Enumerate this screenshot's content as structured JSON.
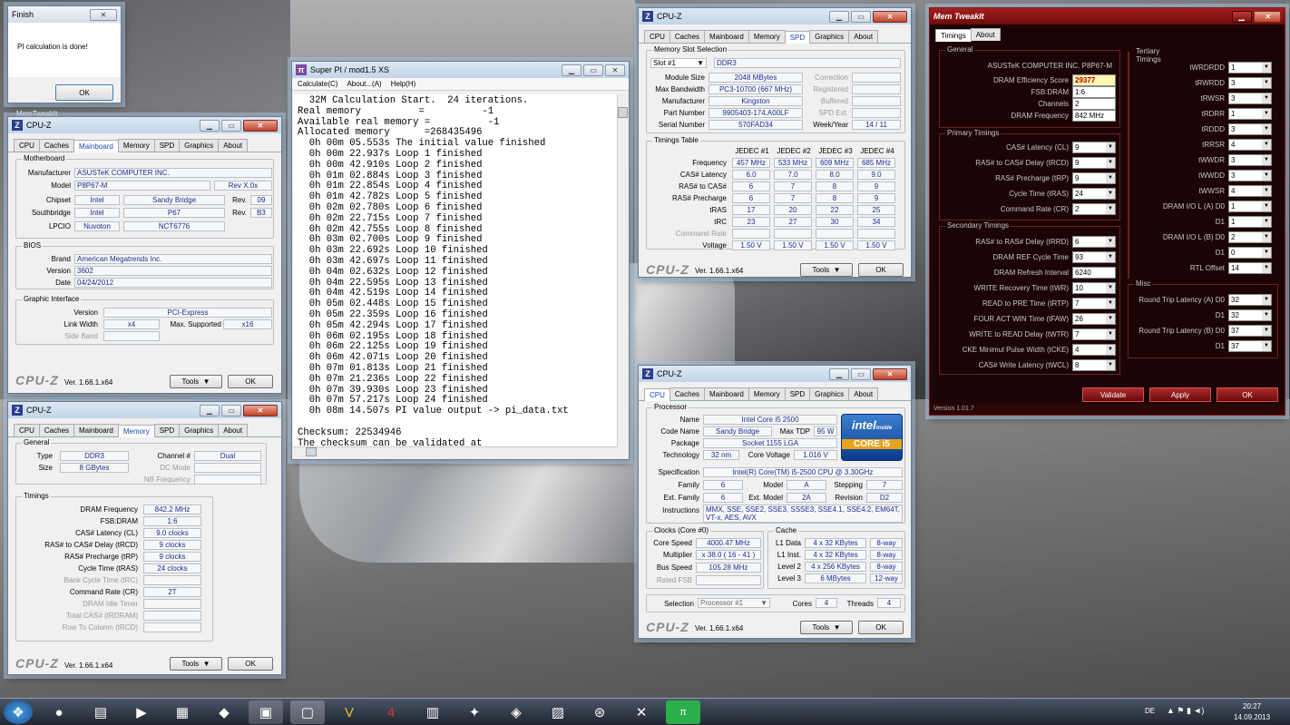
{
  "finish": {
    "title": "Finish",
    "message": "PI calculation is done!",
    "ok": "OK"
  },
  "memtweak_label": "MemTweakIt",
  "superpi": {
    "title": "Super PI / mod1.5 XS",
    "menu": [
      "Calculate(C)",
      "About...(A)",
      "Help(H)"
    ],
    "lines": [
      "  32M Calculation Start.  24 iterations.",
      "Real memory          =          -1",
      "Available real memory =          -1",
      "Allocated memory      =268435496",
      "  0h 00m 05.553s The initial value finished",
      "  0h 00m 22.937s Loop 1 finished",
      "  0h 00m 42.910s Loop 2 finished",
      "  0h 01m 02.884s Loop 3 finished",
      "  0h 01m 22.854s Loop 4 finished",
      "  0h 01m 42.782s Loop 5 finished",
      "  0h 02m 02.780s Loop 6 finished",
      "  0h 02m 22.715s Loop 7 finished",
      "  0h 02m 42.755s Loop 8 finished",
      "  0h 03m 02.700s Loop 9 finished",
      "  0h 03m 22.692s Loop 10 finished",
      "  0h 03m 42.697s Loop 11 finished",
      "  0h 04m 02.632s Loop 12 finished",
      "  0h 04m 22.595s Loop 13 finished",
      "  0h 04m 42.519s Loop 14 finished",
      "  0h 05m 02.448s Loop 15 finished",
      "  0h 05m 22.359s Loop 16 finished",
      "  0h 05m 42.294s Loop 17 finished",
      "  0h 06m 02.195s Loop 18 finished",
      "  0h 06m 22.125s Loop 19 finished",
      "  0h 06m 42.071s Loop 20 finished",
      "  0h 07m 01.813s Loop 21 finished",
      "  0h 07m 21.236s Loop 22 finished",
      "  0h 07m 39.930s Loop 23 finished",
      "  0h 07m 57.217s Loop 24 finished",
      "  0h 08m 14.507s PI value output -> pi_data.txt",
      "",
      "Checksum: 22534946",
      "The checksum can be validated at"
    ]
  },
  "cpuz_common": {
    "title": "CPU-Z",
    "tabs": [
      "CPU",
      "Caches",
      "Mainboard",
      "Memory",
      "SPD",
      "Graphics",
      "About"
    ],
    "version": "Ver. 1.66.1.x64",
    "tools": "Tools",
    "ok": "OK",
    "logo": "CPU-Z"
  },
  "mainboard": {
    "group_mb": "Motherboard",
    "manufacturer_l": "Manufacturer",
    "manufacturer": "ASUSTeK COMPUTER INC.",
    "model_l": "Model",
    "model": "P8P67-M",
    "model_rev": "Rev X.0x",
    "chipset_l": "Chipset",
    "chipset_v": "Intel",
    "chipset_n": "Sandy Bridge",
    "chipset_rev_l": "Rev.",
    "chipset_rev": "09",
    "south_l": "Southbridge",
    "south_v": "Intel",
    "south_n": "P67",
    "south_rev_l": "Rev.",
    "south_rev": "B3",
    "lpcio_l": "LPCIO",
    "lpcio_v": "Nuvoton",
    "lpcio_n": "NCT6776",
    "group_bios": "BIOS",
    "brand_l": "Brand",
    "brand": "American Megatrends Inc.",
    "version_l": "Version",
    "version": "3602",
    "date_l": "Date",
    "date": "04/24/2012",
    "group_gi": "Graphic Interface",
    "gi_version_l": "Version",
    "gi_version": "PCI-Express",
    "lw_l": "Link Width",
    "lw": "x4",
    "ms_l": "Max. Supported",
    "ms": "x16",
    "sb_l": "Side Band"
  },
  "memory": {
    "group_gen": "General",
    "type_l": "Type",
    "type": "DDR3",
    "chan_l": "Channel #",
    "chan": "Dual",
    "size_l": "Size",
    "size": "8 GBytes",
    "dc_l": "DC Mode",
    "nb_l": "NB Frequency",
    "group_tim": "Timings",
    "rows": [
      [
        "DRAM Frequency",
        "842.2 MHz",
        false
      ],
      [
        "FSB:DRAM",
        "1:6",
        false
      ],
      [
        "CAS# Latency (CL)",
        "9.0 clocks",
        false
      ],
      [
        "RAS# to CAS# Delay (tRCD)",
        "9 clocks",
        false
      ],
      [
        "RAS# Precharge (tRP)",
        "9 clocks",
        false
      ],
      [
        "Cycle Time (tRAS)",
        "24 clocks",
        false
      ],
      [
        "Bank Cycle Time (tRC)",
        "",
        true
      ],
      [
        "Command Rate (CR)",
        "2T",
        false
      ],
      [
        "DRAM Idle Timer",
        "",
        true
      ],
      [
        "Total CAS# (tRDRAM)",
        "",
        true
      ],
      [
        "Row To Column (tRCD)",
        "",
        true
      ]
    ]
  },
  "spd": {
    "group_slot": "Memory Slot Selection",
    "slot": "Slot #1",
    "slot_type": "DDR3",
    "rows": [
      [
        "Module Size",
        "2048 MBytes",
        "Correction"
      ],
      [
        "Max Bandwidth",
        "PC3-10700 (667 MHz)",
        "Registered"
      ],
      [
        "Manufacturer",
        "Kingston",
        "Buffered"
      ],
      [
        "Part Number",
        "9905403-174.A00LF",
        "SPD Ext."
      ],
      [
        "Serial Number",
        "570FAD34",
        "Week/Year"
      ]
    ],
    "weekyear": "14 / 11",
    "group_tt": "Timings Table",
    "cols": [
      "JEDEC #1",
      "JEDEC #2",
      "JEDEC #3",
      "JEDEC #4"
    ],
    "trows": [
      [
        "Frequency",
        "457 MHz",
        "533 MHz",
        "609 MHz",
        "685 MHz"
      ],
      [
        "CAS# Latency",
        "6.0",
        "7.0",
        "8.0",
        "9.0"
      ],
      [
        "RAS# to CAS#",
        "6",
        "7",
        "8",
        "9"
      ],
      [
        "RAS# Precharge",
        "6",
        "7",
        "8",
        "9"
      ],
      [
        "tRAS",
        "17",
        "20",
        "22",
        "25"
      ],
      [
        "tRC",
        "23",
        "27",
        "30",
        "34"
      ],
      [
        "Command Rate",
        "",
        "",
        "",
        ""
      ],
      [
        "Voltage",
        "1.50 V",
        "1.50 V",
        "1.50 V",
        "1.50 V"
      ]
    ]
  },
  "cpu": {
    "group_proc": "Processor",
    "name_l": "Name",
    "name": "Intel Core i5 2500",
    "code_l": "Code Name",
    "code": "Sandy Bridge",
    "tdp_l": "Max TDP",
    "tdp": "95 W",
    "pkg_l": "Package",
    "pkg": "Socket 1155 LGA",
    "tech_l": "Technology",
    "tech": "32 nm",
    "volt_l": "Core Voltage",
    "volt": "1.016 V",
    "spec_l": "Specification",
    "spec": "Intel(R) Core(TM) i5-2500 CPU @ 3.30GHz",
    "fam_l": "Family",
    "fam": "6",
    "model_l": "Model",
    "model": "A",
    "step_l": "Stepping",
    "step": "7",
    "efam_l": "Ext. Family",
    "efam": "6",
    "emod_l": "Ext. Model",
    "emod": "2A",
    "rev_l": "Revision",
    "rev": "D2",
    "instr_l": "Instructions",
    "instr": "MMX, SSE, SSE2, SSE3, SSSE3, SSE4.1, SSE4.2, EM64T, VT-x, AES, AVX",
    "group_clk": "Clocks (Core #0)",
    "cs_l": "Core Speed",
    "cs": "4000.47 MHz",
    "mult_l": "Multiplier",
    "mult": "x 38.0 ( 16 - 41 )",
    "bus_l": "Bus Speed",
    "bus": "105.28 MHz",
    "fsb_l": "Rated FSB",
    "group_cache": "Cache",
    "caches": [
      [
        "L1 Data",
        "4 x 32 KBytes",
        "8-way"
      ],
      [
        "L1 Inst.",
        "4 x 32 KBytes",
        "8-way"
      ],
      [
        "Level 2",
        "4 x 256 KBytes",
        "8-way"
      ],
      [
        "Level 3",
        "6 MBytes",
        "12-way"
      ]
    ],
    "sel_l": "Selection",
    "sel": "Processor #1",
    "cores_l": "Cores",
    "cores": "4",
    "threads_l": "Threads",
    "threads": "4",
    "intel_top": "intel",
    "intel_inside": "inside",
    "intel_core": "CORE i5"
  },
  "mt": {
    "title": "Mem TweakIt",
    "tabs": [
      "Timings",
      "About"
    ],
    "g_general": "General",
    "board": "ASUSTeK COMPUTER INC. P8P67-M",
    "gen": [
      [
        "DRAM Efficiency Score",
        "29377"
      ],
      [
        "FSB:DRAM",
        "1:6"
      ],
      [
        "Channels",
        "2"
      ],
      [
        "DRAM Frequency",
        "842 MHz"
      ]
    ],
    "g_primary": "Primary Timings",
    "primary": [
      [
        "CAS# Latency (CL)",
        "9"
      ],
      [
        "RAS# to CAS# Delay (tRCD)",
        "9"
      ],
      [
        "RAS# Precharge (tRP)",
        "9"
      ],
      [
        "Cycle Time (tRAS)",
        "24"
      ],
      [
        "Command Rate (CR)",
        "2"
      ]
    ],
    "g_secondary": "Secondary Timings",
    "secondary": [
      [
        "RAS# to RAS# Delay (tRRD)",
        "6"
      ],
      [
        "DRAM REF Cycle Time",
        "93"
      ],
      [
        "DRAM Refresh Interval",
        "6240"
      ],
      [
        "WRITE Recovery Time (tWR)",
        "10"
      ],
      [
        "READ to PRE Time (tRTP)",
        "7"
      ],
      [
        "FOUR ACT WIN Time (tFAW)",
        "26"
      ],
      [
        "WRITE to READ Delay (tWTR)",
        "7"
      ],
      [
        "CKE Minimul Pulse Width (tCKE)",
        "4"
      ],
      [
        "CAS# Write Latency (tWCL)",
        "8"
      ]
    ],
    "g_tertiary": "Tertiary Timings",
    "tertiary": [
      [
        "tWRDRDD",
        "1"
      ],
      [
        "tRWRDD",
        "3"
      ],
      [
        "tRWSR",
        "3"
      ],
      [
        "tRDRR",
        "1"
      ],
      [
        "tRDDD",
        "3"
      ],
      [
        "tRRSR",
        "4"
      ],
      [
        "tWWDR",
        "3"
      ],
      [
        "tWWDD",
        "3"
      ],
      [
        "tWWSR",
        "4"
      ],
      [
        "DRAM I/O L (A)  D0",
        "1"
      ],
      [
        "D1",
        "1"
      ],
      [
        "DRAM I/O L (B)  D0",
        "2"
      ],
      [
        "D1",
        "0"
      ],
      [
        "RTL Offset",
        "14"
      ]
    ],
    "g_misc": "Misc",
    "misc": [
      [
        "Round Trip Latency (A)  D0",
        "32"
      ],
      [
        "D1",
        "32"
      ],
      [
        "Round Trip Latency (B)  D0",
        "37"
      ],
      [
        "D1",
        "37"
      ]
    ],
    "validate": "Validate",
    "apply": "Apply",
    "ok": "OK",
    "version": "Version 1.01.7"
  },
  "taskbar": {
    "lang": "DE",
    "time": "20:27",
    "date": "14.09.2013"
  }
}
